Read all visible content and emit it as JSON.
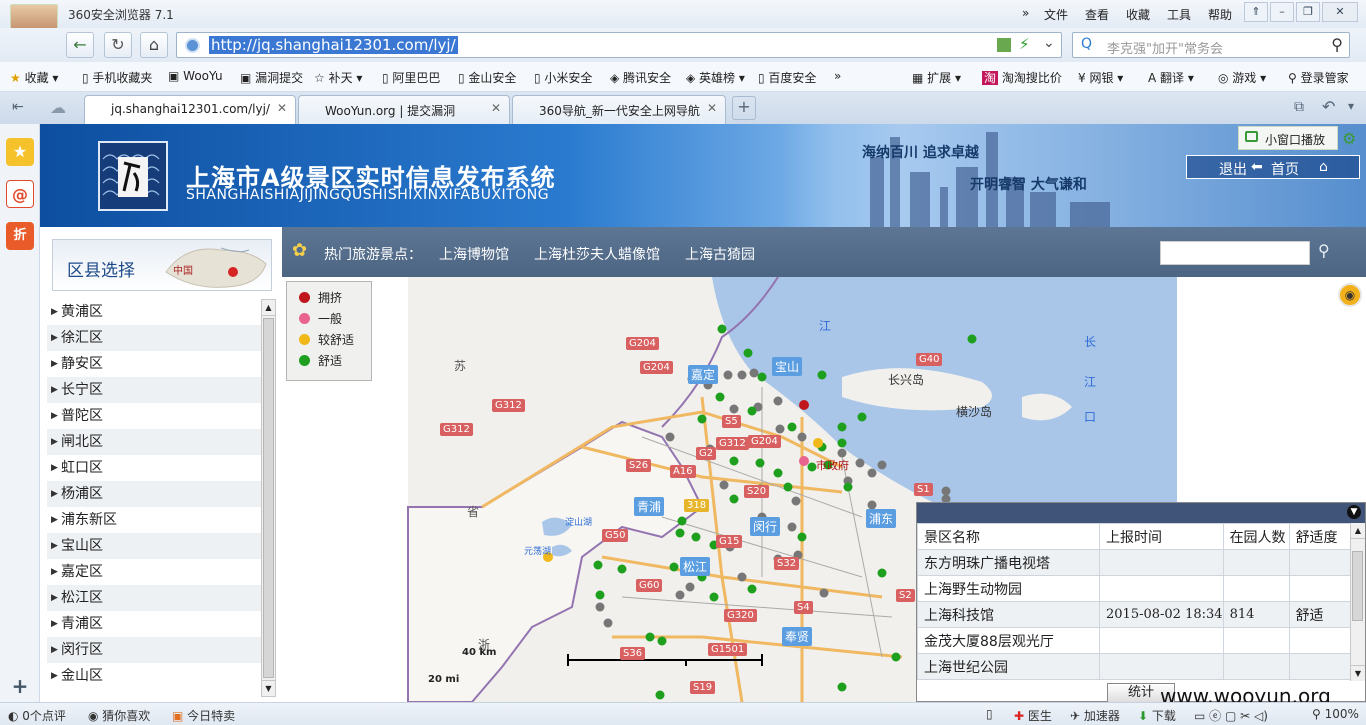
{
  "browser": {
    "app_title": "360安全浏览器 7.1",
    "menu": [
      "文件",
      "查看",
      "收藏",
      "工具",
      "帮助"
    ],
    "address": "http://jq.shanghai12301.com/lyj/",
    "search_placeholder": "李克强\"加开\"常务会",
    "bookmarks": [
      "收藏",
      "手机收藏夹",
      "WooYu",
      "漏洞提交",
      "补天",
      "阿里巴巴",
      "金山安全",
      "小米安全",
      "腾讯安全",
      "英雄榜",
      "百度安全"
    ],
    "toolbar_right": [
      "扩展",
      "淘淘搜比价",
      "网银",
      "翻译",
      "游戏",
      "登录管家"
    ],
    "tabs": [
      {
        "label": "jq.shanghai12301.com/lyj/"
      },
      {
        "label": "WooYun.org | 提交漏洞"
      },
      {
        "label": "360导航_新一代安全上网导航"
      }
    ],
    "mini_window": "小窗口播放",
    "status_left": [
      "0个点评",
      "猜你喜欢",
      "今日特卖"
    ],
    "status_right": [
      "医生",
      "加速器",
      "下载",
      "100%"
    ]
  },
  "site": {
    "title": "上海市A级景区实时信息发布系统",
    "subtitle": "SHANGHAISHIAJIJINGQUSHISHIXINXIFABUXITONG",
    "slogan1": "海纳百川  追求卓越",
    "slogan2": "开明睿智  大气谦和",
    "logout": "退出",
    "home": "首页",
    "hot_label": "热门旅游景点：",
    "hot_spots": [
      "上海博物馆",
      "上海杜莎夫人蜡像馆",
      "上海古猗园"
    ]
  },
  "district": {
    "title": "区县选择",
    "map_label": "中国",
    "items": [
      "黄浦区",
      "徐汇区",
      "静安区",
      "长宁区",
      "普陀区",
      "闸北区",
      "虹口区",
      "杨浦区",
      "浦东新区",
      "宝山区",
      "嘉定区",
      "松江区",
      "青浦区",
      "闵行区",
      "金山区"
    ]
  },
  "legend": [
    {
      "label": "拥挤",
      "color": "#c0171c"
    },
    {
      "label": "一般",
      "color": "#e8638f"
    },
    {
      "label": "较舒适",
      "color": "#f0b818"
    },
    {
      "label": "舒适",
      "color": "#1ea01e"
    }
  ],
  "map": {
    "labels": [
      "江",
      "长",
      "江",
      "口",
      "长兴岛",
      "横沙岛",
      "苏",
      "省",
      "浙",
      "市政府",
      "淀山湖",
      "元荡湖"
    ],
    "roads": [
      "G204",
      "G204",
      "G312",
      "G312",
      "G40",
      "S5",
      "G312",
      "G204",
      "G2",
      "S26",
      "A16",
      "S20",
      "G50",
      "G15",
      "S32",
      "G60",
      "S4",
      "G320",
      "S36",
      "G1501",
      "S19",
      "S1",
      "S2",
      "318"
    ],
    "areas": [
      "嘉定",
      "宝山",
      "青浦",
      "闵行",
      "浦东",
      "松江",
      "奉贤"
    ],
    "scale_km": "40 km",
    "scale_mi": "20 mi"
  },
  "panel": {
    "columns": [
      "景区名称",
      "上报时间",
      "在园人数",
      "舒适度"
    ],
    "rows": [
      [
        "东方明珠广播电视塔",
        "",
        "",
        ""
      ],
      [
        "上海野生动物园",
        "",
        "",
        ""
      ],
      [
        "上海科技馆",
        "2015-08-02 18:34",
        "814",
        "舒适"
      ],
      [
        "金茂大厦88层观光厅",
        "",
        "",
        ""
      ],
      [
        "上海世纪公园",
        "",
        "",
        ""
      ]
    ],
    "button": "统计"
  },
  "watermark": "www.wooyun.org"
}
